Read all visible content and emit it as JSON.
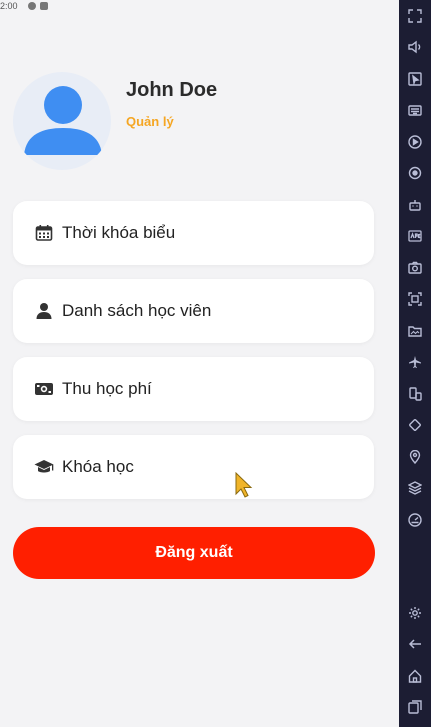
{
  "status_bar": {
    "time": "2:00"
  },
  "profile": {
    "name": "John Doe",
    "role": "Quản lý"
  },
  "menu": {
    "items": [
      {
        "label": "Thời khóa biểu",
        "icon": "calendar-icon"
      },
      {
        "label": "Danh sách học viên",
        "icon": "person-icon"
      },
      {
        "label": "Thu học phí",
        "icon": "money-icon"
      },
      {
        "label": "Khóa học",
        "icon": "graduation-cap-icon"
      }
    ]
  },
  "logout_label": "Đăng xuất",
  "emulator_toolbar": {
    "top": [
      "fullscreen-icon",
      "volume-icon",
      "cursor-icon",
      "keyboard-icon",
      "record-icon",
      "sync-icon",
      "robot-icon",
      "apk-icon",
      "screenshot-icon",
      "crop-icon",
      "folder-icon",
      "airplane-icon",
      "multi-instance-icon",
      "rotate-icon",
      "location-icon",
      "layers-icon",
      "speed-icon"
    ],
    "bottom": [
      "settings-icon",
      "back-icon",
      "home-icon",
      "recent-apps-icon"
    ]
  },
  "colors": {
    "logout": "#ff1f00",
    "role": "#f5a623",
    "avatar": "#4a90f0",
    "toolbar": "#1c1d33"
  }
}
